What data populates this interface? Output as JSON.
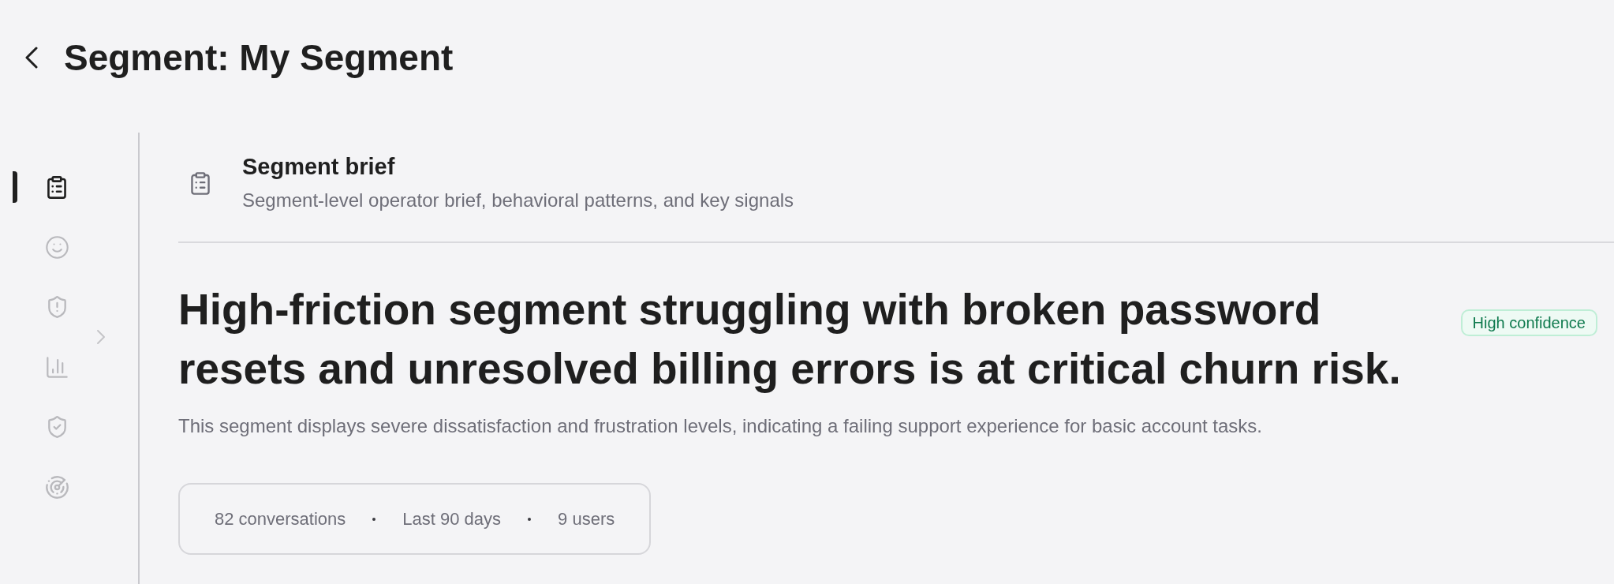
{
  "header": {
    "title": "Segment: My Segment"
  },
  "sidebar": {
    "items": [
      {
        "selected": true
      },
      {
        "selected": false
      },
      {
        "selected": false
      },
      {
        "selected": false
      },
      {
        "selected": false
      },
      {
        "selected": false
      }
    ]
  },
  "section": {
    "title": "Segment brief",
    "subtitle": "Segment-level operator brief, behavioral patterns, and key signals"
  },
  "summary": {
    "headline": "High-friction segment struggling with broken password resets and unresolved billing errors is at critical churn risk.",
    "confidence_badge": "High confidence",
    "description": "This segment displays severe dissatisfaction and frustration levels, indicating a failing support experience for basic account tasks.",
    "stats": [
      "82 conversations",
      "Last 90 days",
      "9 users"
    ]
  }
}
